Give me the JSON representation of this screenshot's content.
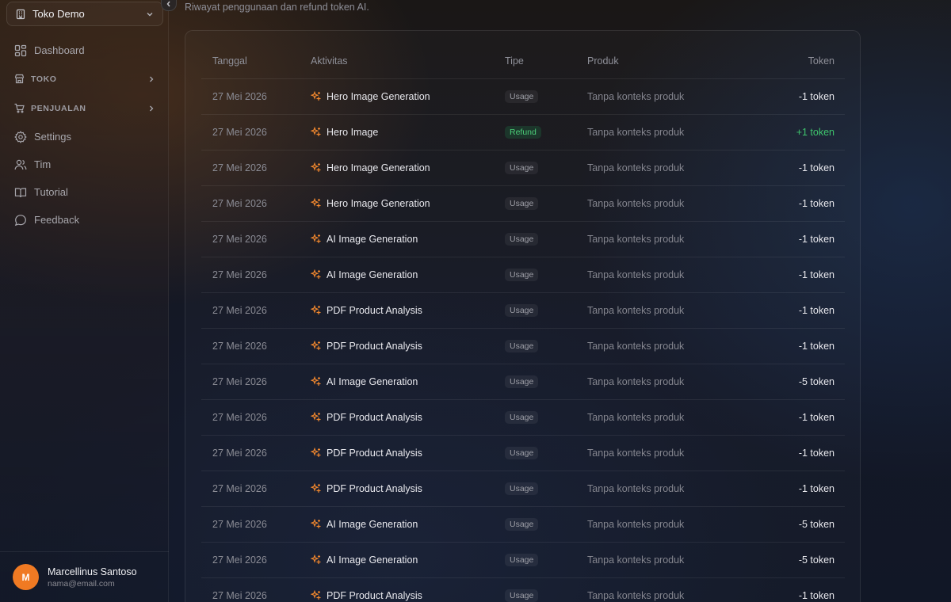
{
  "sidebar": {
    "store_name": "Toko Demo",
    "items": [
      {
        "label": "Dashboard",
        "icon": "dashboard-icon",
        "section": false
      },
      {
        "label": "TOKO",
        "icon": "store-icon",
        "section": true
      },
      {
        "label": "PENJUALAN",
        "icon": "cart-icon",
        "section": true
      },
      {
        "label": "Settings",
        "icon": "gear-icon",
        "section": false
      },
      {
        "label": "Tim",
        "icon": "users-icon",
        "section": false
      },
      {
        "label": "Tutorial",
        "icon": "book-icon",
        "section": false
      },
      {
        "label": "Feedback",
        "icon": "chat-icon",
        "section": false
      }
    ],
    "user": {
      "initial": "M",
      "name": "Marcellinus Santoso",
      "email": "nama@email.com"
    }
  },
  "main": {
    "subtitle": "Riwayat penggunaan dan refund token AI.",
    "table": {
      "headers": {
        "date": "Tanggal",
        "activity": "Aktivitas",
        "type": "Tipe",
        "product": "Produk",
        "token": "Token"
      },
      "rows": [
        {
          "date": "27 Mei 2026",
          "activity": "Hero Image Generation",
          "type": "Usage",
          "product": "Tanpa konteks produk",
          "token": "-1 token"
        },
        {
          "date": "27 Mei 2026",
          "activity": "Hero Image",
          "type": "Refund",
          "product": "Tanpa konteks produk",
          "token": "+1 token"
        },
        {
          "date": "27 Mei 2026",
          "activity": "Hero Image Generation",
          "type": "Usage",
          "product": "Tanpa konteks produk",
          "token": "-1 token"
        },
        {
          "date": "27 Mei 2026",
          "activity": "Hero Image Generation",
          "type": "Usage",
          "product": "Tanpa konteks produk",
          "token": "-1 token"
        },
        {
          "date": "27 Mei 2026",
          "activity": "AI Image Generation",
          "type": "Usage",
          "product": "Tanpa konteks produk",
          "token": "-1 token"
        },
        {
          "date": "27 Mei 2026",
          "activity": "AI Image Generation",
          "type": "Usage",
          "product": "Tanpa konteks produk",
          "token": "-1 token"
        },
        {
          "date": "27 Mei 2026",
          "activity": "PDF Product Analysis",
          "type": "Usage",
          "product": "Tanpa konteks produk",
          "token": "-1 token"
        },
        {
          "date": "27 Mei 2026",
          "activity": "PDF Product Analysis",
          "type": "Usage",
          "product": "Tanpa konteks produk",
          "token": "-1 token"
        },
        {
          "date": "27 Mei 2026",
          "activity": "AI Image Generation",
          "type": "Usage",
          "product": "Tanpa konteks produk",
          "token": "-5 token"
        },
        {
          "date": "27 Mei 2026",
          "activity": "PDF Product Analysis",
          "type": "Usage",
          "product": "Tanpa konteks produk",
          "token": "-1 token"
        },
        {
          "date": "27 Mei 2026",
          "activity": "PDF Product Analysis",
          "type": "Usage",
          "product": "Tanpa konteks produk",
          "token": "-1 token"
        },
        {
          "date": "27 Mei 2026",
          "activity": "PDF Product Analysis",
          "type": "Usage",
          "product": "Tanpa konteks produk",
          "token": "-1 token"
        },
        {
          "date": "27 Mei 2026",
          "activity": "AI Image Generation",
          "type": "Usage",
          "product": "Tanpa konteks produk",
          "token": "-5 token"
        },
        {
          "date": "27 Mei 2026",
          "activity": "AI Image Generation",
          "type": "Usage",
          "product": "Tanpa konteks produk",
          "token": "-5 token"
        },
        {
          "date": "27 Mei 2026",
          "activity": "PDF Product Analysis",
          "type": "Usage",
          "product": "Tanpa konteks produk",
          "token": "-1 token"
        }
      ]
    }
  },
  "colors": {
    "accent": "#f07a23",
    "refund": "#3fc56d",
    "activity_icon": "#f0872e"
  }
}
